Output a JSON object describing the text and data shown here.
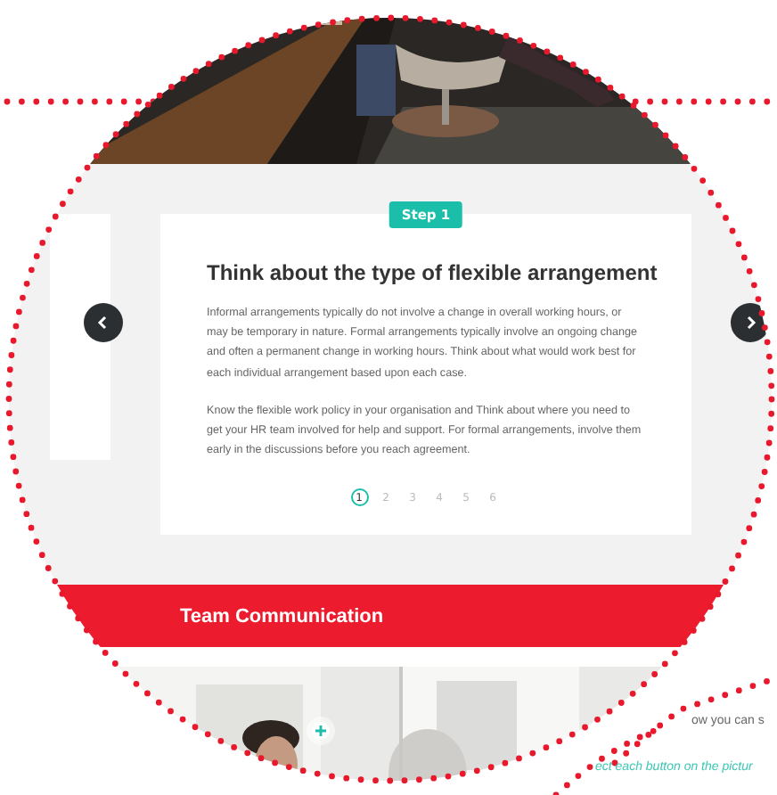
{
  "carousel": {
    "step_badge": "Step 1",
    "title": "Think about the type of flexible arrangement",
    "paragraphs": [
      "Informal arrangements typically do not involve a change in overall working hours, or may be temporary in nature.  Formal arrangements typically involve an ongoing change and often a permanent change in working hours. Think about what would work best for each individual arrangement based upon each case.",
      "Know the flexible work policy in your organisation and Think about where you need to get your HR team involved for help and support.  For formal arrangements, involve them early in the discussions before you reach agreement."
    ],
    "pages": [
      {
        "label": "1",
        "selected": true
      },
      {
        "label": "2",
        "selected": false
      },
      {
        "label": "3",
        "selected": false
      },
      {
        "label": "4",
        "selected": false
      },
      {
        "label": "5",
        "selected": false
      },
      {
        "label": "6",
        "selected": false
      }
    ]
  },
  "section_heading": "Team Communication",
  "behind_text": [
    {
      "text": "ow you can s",
      "kind": "plain"
    },
    {
      "text": "ect each button on the pictur",
      "kind": "hint"
    }
  ]
}
